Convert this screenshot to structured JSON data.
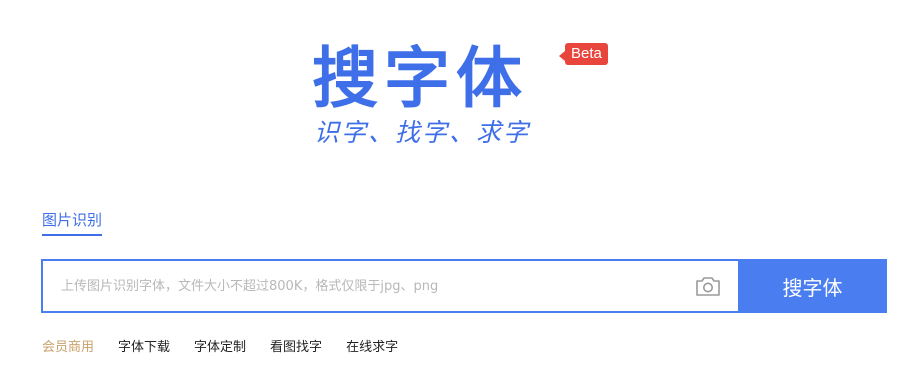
{
  "logo": {
    "title": "搜字体",
    "badge": "Beta",
    "slogan": "识字、找字、求字"
  },
  "tabs": {
    "active": "图片识别"
  },
  "search": {
    "placeholder": "上传图片识别字体，文件大小不超过800K，格式仅限于jpg、png",
    "value": "",
    "button_label": "搜字体",
    "upload_icon": "camera-icon"
  },
  "nav": {
    "items": [
      {
        "label": "会员商用"
      },
      {
        "label": "字体下载"
      },
      {
        "label": "字体定制"
      },
      {
        "label": "看图找字"
      },
      {
        "label": "在线求字"
      }
    ]
  },
  "colors": {
    "brand": "#3f6fe8",
    "button": "#4a7ef0",
    "badge": "#e8453c",
    "vip": "#c9a06b"
  }
}
